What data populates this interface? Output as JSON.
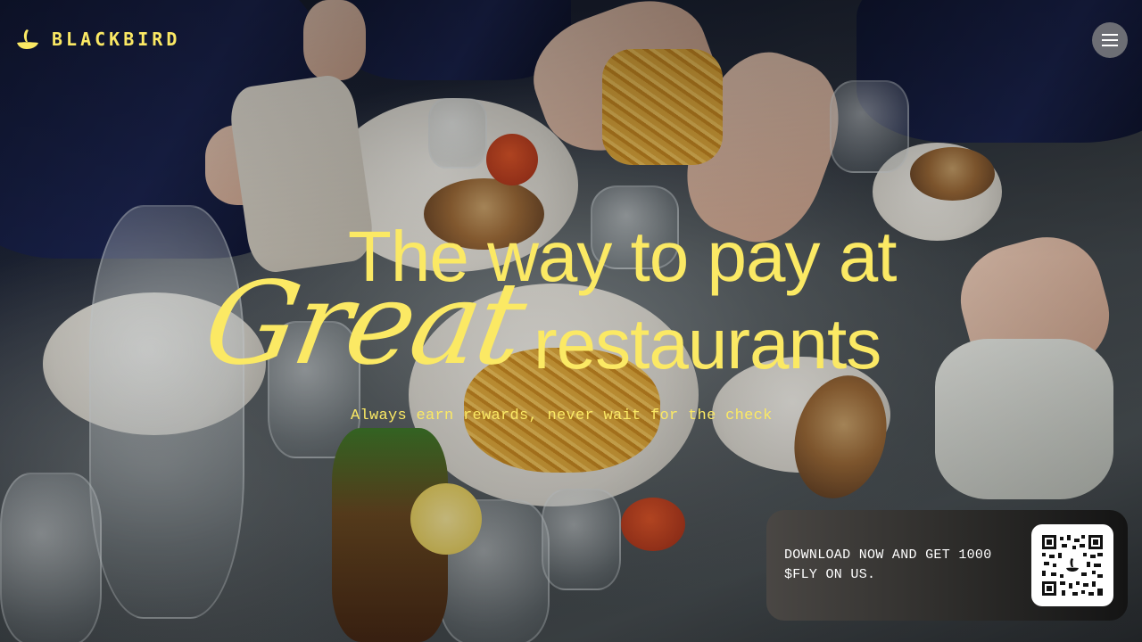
{
  "header": {
    "brand": "BLACKBIRD",
    "logo_icon": "blackbird-logo-icon",
    "menu_icon": "hamburger-menu-icon"
  },
  "hero": {
    "line1": "The way to pay at",
    "great": "Great",
    "line2": "restaurants",
    "subtitle": "Always earn rewards, never wait for the check"
  },
  "download_card": {
    "text": "DOWNLOAD NOW AND GET 1000 $FLY ON US.",
    "qr_icon": "qr-code-icon"
  },
  "colors": {
    "accent": "#fbe964",
    "card_dark": "#141414",
    "menu_button": "#8c8c8c"
  }
}
